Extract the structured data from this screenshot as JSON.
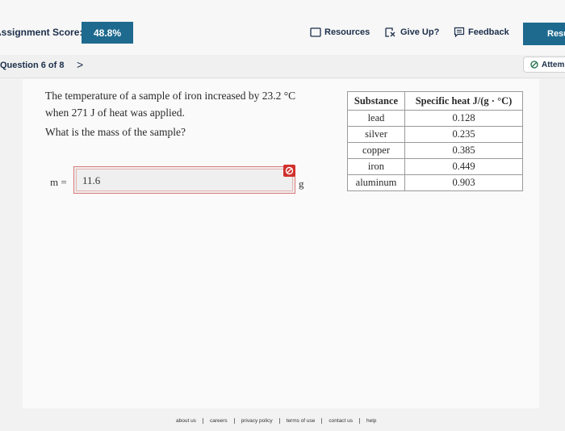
{
  "header": {
    "score_label": "Assignment Score:",
    "score_value": "48.8%",
    "resources_label": "Resources",
    "giveup_label": "Give Up?",
    "feedback_label": "Feedback",
    "results_label": "Resu"
  },
  "question_nav": {
    "label": "Question 6 of 8",
    "next_symbol": ">",
    "attempt_label": "Attem"
  },
  "question": {
    "line1": "The temperature of a sample of iron increased by 23.2 °C",
    "line2": "when 271 J of heat was applied.",
    "ask": "What is the mass of the sample?"
  },
  "answer": {
    "variable": "m =",
    "value": "11.6",
    "unit": "g"
  },
  "table": {
    "headers": [
      "Substance",
      "Specific heat J/(g · °C)"
    ],
    "rows": [
      [
        "lead",
        "0.128"
      ],
      [
        "silver",
        "0.235"
      ],
      [
        "copper",
        "0.385"
      ],
      [
        "iron",
        "0.449"
      ],
      [
        "aluminum",
        "0.903"
      ]
    ]
  },
  "footer": {
    "links": [
      "about us",
      "careers",
      "privacy policy",
      "terms of use",
      "contact us",
      "help"
    ]
  },
  "colors": {
    "accent": "#1e6a8f",
    "error": "#d0312d",
    "nav_text": "#1b2e4a"
  }
}
